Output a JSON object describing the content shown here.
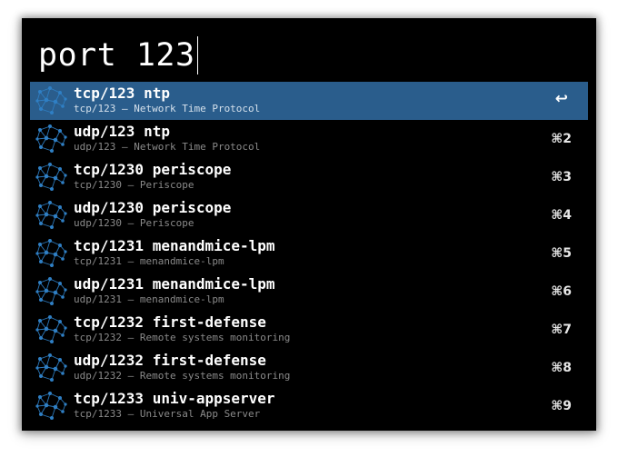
{
  "search": {
    "query": "port 123"
  },
  "results": [
    {
      "title": "tcp/123 ntp",
      "subtitle": "tcp/123 – Network Time Protocol",
      "shortcut": "↩",
      "selected": true,
      "icon": "network-nodes-icon"
    },
    {
      "title": "udp/123 ntp",
      "subtitle": "udp/123 – Network Time Protocol",
      "shortcut": "⌘2",
      "selected": false,
      "icon": "network-nodes-icon"
    },
    {
      "title": "tcp/1230 periscope",
      "subtitle": "tcp/1230 – Periscope",
      "shortcut": "⌘3",
      "selected": false,
      "icon": "network-nodes-icon"
    },
    {
      "title": "udp/1230 periscope",
      "subtitle": "udp/1230 – Periscope",
      "shortcut": "⌘4",
      "selected": false,
      "icon": "network-nodes-icon"
    },
    {
      "title": "tcp/1231 menandmice-lpm",
      "subtitle": "tcp/1231 – menandmice-lpm",
      "shortcut": "⌘5",
      "selected": false,
      "icon": "network-nodes-icon"
    },
    {
      "title": "udp/1231 menandmice-lpm",
      "subtitle": "udp/1231 – menandmice-lpm",
      "shortcut": "⌘6",
      "selected": false,
      "icon": "network-nodes-icon"
    },
    {
      "title": "tcp/1232 first-defense",
      "subtitle": "tcp/1232 – Remote systems monitoring",
      "shortcut": "⌘7",
      "selected": false,
      "icon": "network-nodes-icon"
    },
    {
      "title": "udp/1232 first-defense",
      "subtitle": "udp/1232 – Remote systems monitoring",
      "shortcut": "⌘8",
      "selected": false,
      "icon": "network-nodes-icon"
    },
    {
      "title": "tcp/1233 univ-appserver",
      "subtitle": "tcp/1233 – Universal App Server",
      "shortcut": "⌘9",
      "selected": false,
      "icon": "network-nodes-icon"
    }
  ],
  "colors": {
    "background": "#000000",
    "selection": "#2a5d8c",
    "icon": "#2f7fc4"
  }
}
